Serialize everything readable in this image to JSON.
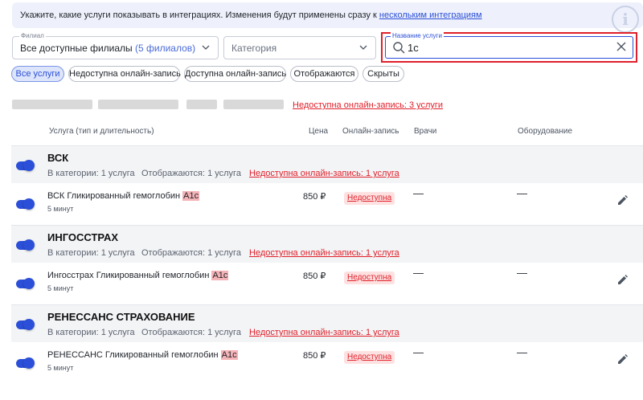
{
  "colors": {
    "accent": "#2b4fd8",
    "danger": "#e0202a",
    "group_bg": "#f3f4f6",
    "highlight": "#f4b3b6"
  },
  "banner": {
    "text": "Укажите, какие услуги показывать в интеграциях. Изменения будут применены сразу к ",
    "link": "нескольким интеграциям",
    "icon": "info-icon"
  },
  "filters": {
    "branch": {
      "label": "Филиал",
      "value": "Все доступные филиалы",
      "count": "(5 филиалов)"
    },
    "category": {
      "placeholder": "Категория"
    },
    "search": {
      "label": "Название услуги",
      "value": "1c"
    }
  },
  "chips": [
    "Все услуги",
    "Недоступна онлайн-запись",
    "Доступна онлайн-запись",
    "Отображаются",
    "Скрыты"
  ],
  "summary": {
    "link": "Недоступна онлайн-запись: 3 услуги"
  },
  "table": {
    "headers": {
      "service": "Услуга (тип и длительность)",
      "price": "Цена",
      "online": "Онлайн-запись",
      "doctors": "Врачи",
      "equipment": "Оборудование"
    }
  },
  "groups": [
    {
      "name": "ВСК",
      "in_category": "В категории: 1 услуга",
      "shown": "Отображаются: 1 услуга",
      "unavailable": "Недоступна онлайн-запись: 1 услуга",
      "service": {
        "name_prefix": "ВСК Гликированный гемоглобин ",
        "name_highlight": "A1c",
        "duration": "5 минут",
        "price": "850 ₽",
        "online": "Недоступна",
        "doctors": "—",
        "equipment": "—"
      }
    },
    {
      "name": "ИНГОССТРАХ",
      "in_category": "В категории: 1 услуга",
      "shown": "Отображаются: 1 услуга",
      "unavailable": "Недоступна онлайн-запись: 1 услуга",
      "service": {
        "name_prefix": "Ингосстрах Гликированный гемоглобин ",
        "name_highlight": "A1c",
        "duration": "5 минут",
        "price": "850 ₽",
        "online": "Недоступна",
        "doctors": "—",
        "equipment": "—"
      }
    },
    {
      "name": "РЕНЕССАНС СТРАХОВАНИЕ",
      "in_category": "В категории: 1 услуга",
      "shown": "Отображаются: 1 услуга",
      "unavailable": "Недоступна онлайн-запись: 1 услуга",
      "service": {
        "name_prefix": "РЕНЕССАНС Гликированный гемоглобин ",
        "name_highlight": "A1c",
        "duration": "5 минут",
        "price": "850 ₽",
        "online": "Недоступна",
        "doctors": "—",
        "equipment": "—"
      }
    }
  ]
}
